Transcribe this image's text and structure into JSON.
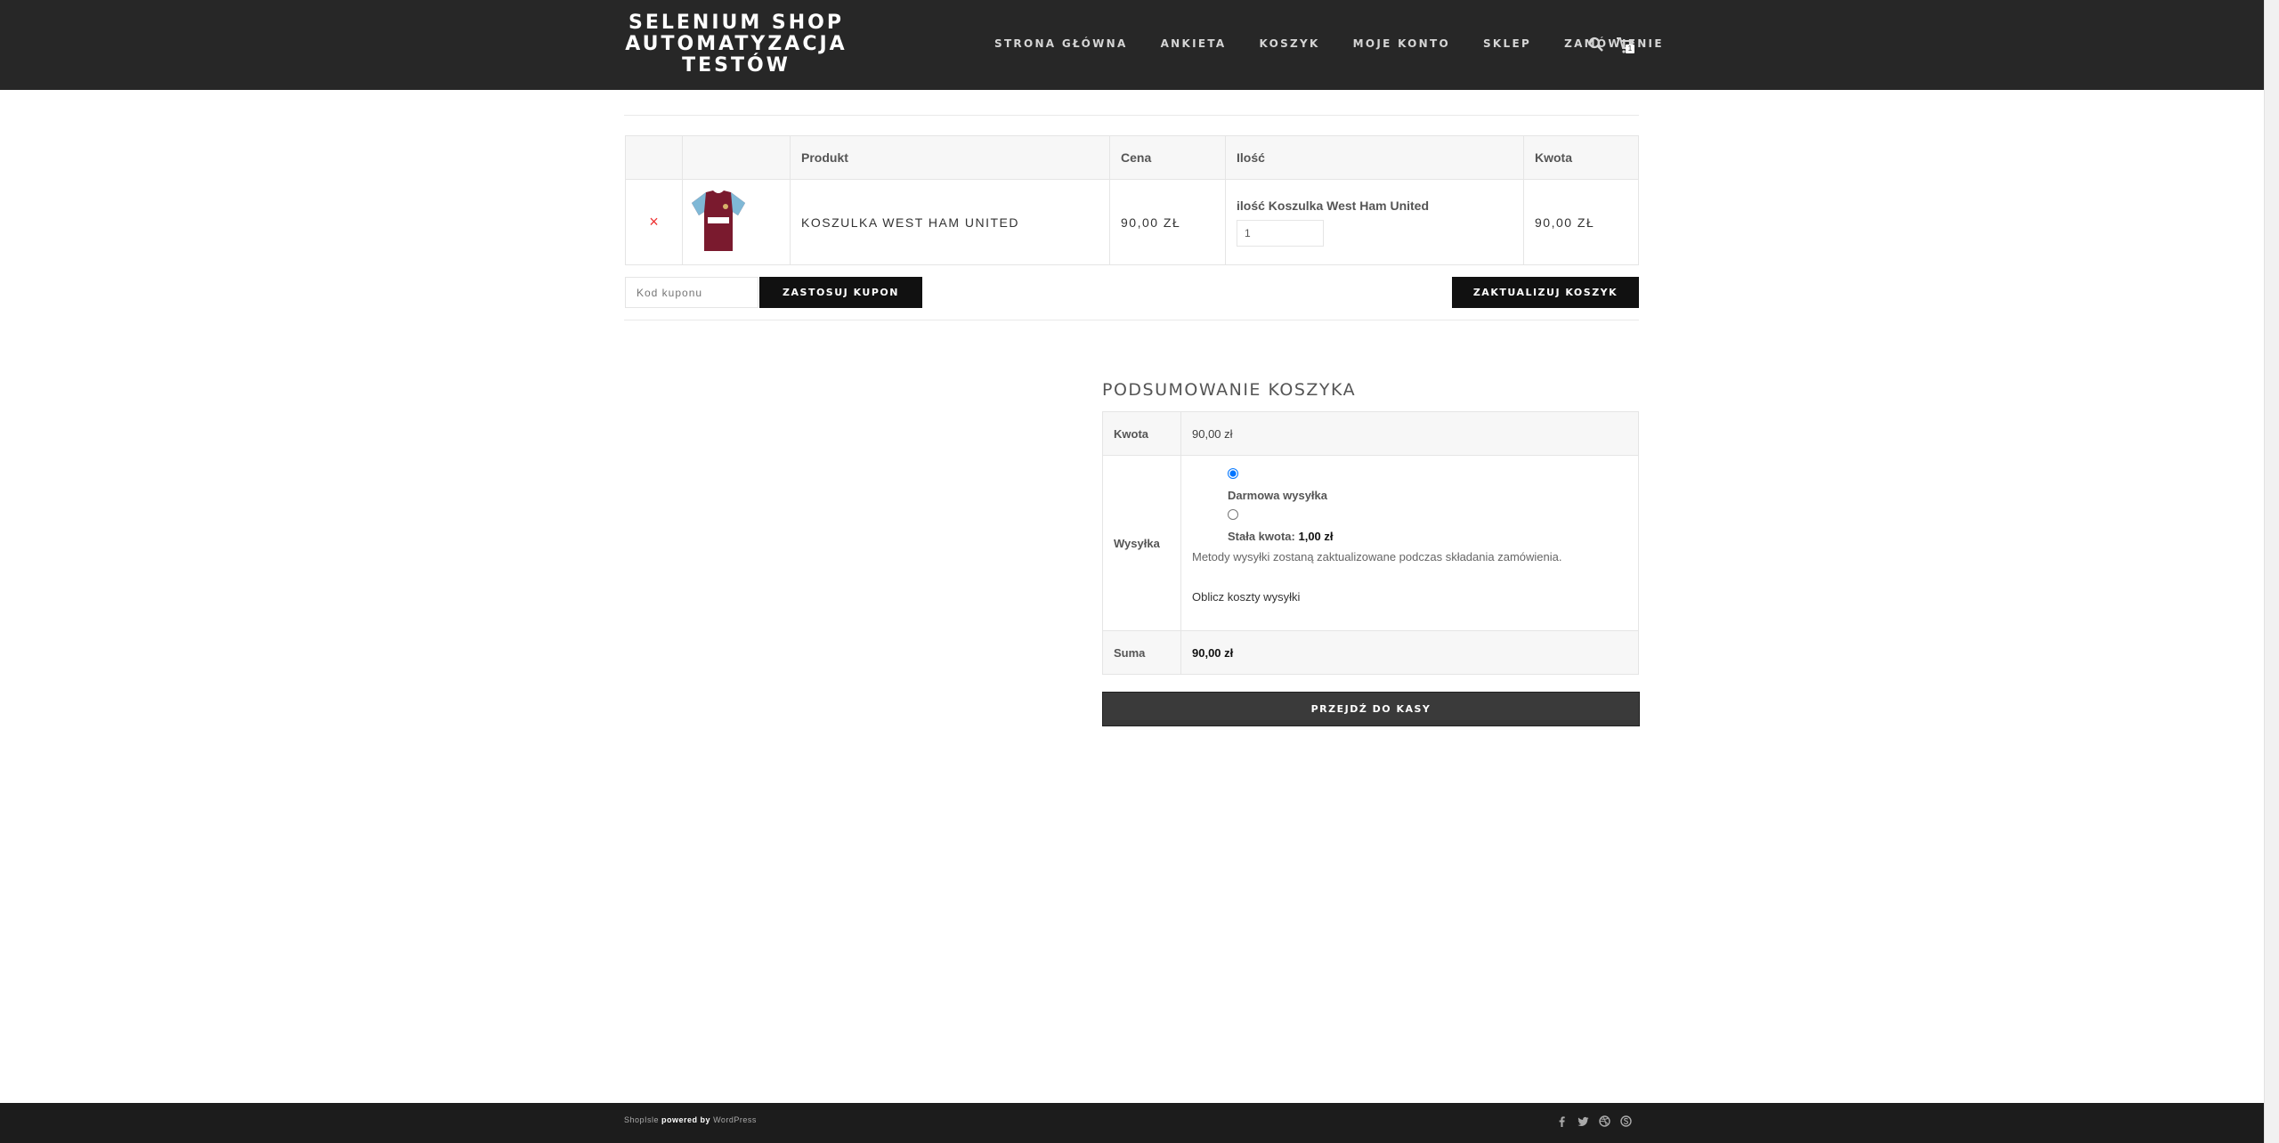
{
  "brand": {
    "line1": "SELENIUM SHOP",
    "line2": "AUTOMATYZACJA",
    "line3": "TESTÓW"
  },
  "nav": [
    "STRONA GŁÓWNA",
    "ANKIETA",
    "KOSZYK",
    "MOJE KONTO",
    "SKLEP",
    "ZAMÓWIENIE"
  ],
  "cart_count": "1",
  "cart": {
    "headers": [
      "",
      "",
      "Produkt",
      "Cena",
      "Ilość",
      "Kwota"
    ],
    "items": [
      {
        "remove": "×",
        "name": "KOSZULKA WEST HAM UNITED",
        "price": "90,00 ZŁ",
        "qty_label": "ilość Koszulka West Ham United",
        "qty": "1",
        "subtotal": "90,00 ZŁ"
      }
    ]
  },
  "coupon": {
    "placeholder": "Kod kuponu",
    "apply_label": "ZASTOSUJ KUPON"
  },
  "update_label": "ZAKTUALIZUJ KOSZYK",
  "totals": {
    "title": "PODSUMOWANIE KOSZYKA",
    "subtotal_label": "Kwota",
    "subtotal": "90,00 zł",
    "shipping_label": "Wysyłka",
    "ship_free": "Darmowa wysyłka",
    "ship_flat_prefix": "Stała kwota:",
    "ship_flat_amount": "1,00 zł",
    "ship_note": "Metody wysyłki zostaną zaktualizowane podczas składania zamówienia.",
    "calc_link": "Oblicz koszty wysyłki",
    "total_label": "Suma",
    "total": "90,00 zł"
  },
  "checkout_label": "PRZEJDŹ DO KASY",
  "footer": {
    "shop": "ShopIsle",
    "powered": "powered by",
    "wp": "WordPress"
  },
  "colors": {
    "navbar": "#272727",
    "accent_remove": "#e33333",
    "button_dark": "#111111",
    "footer": "#1c1c1c"
  }
}
